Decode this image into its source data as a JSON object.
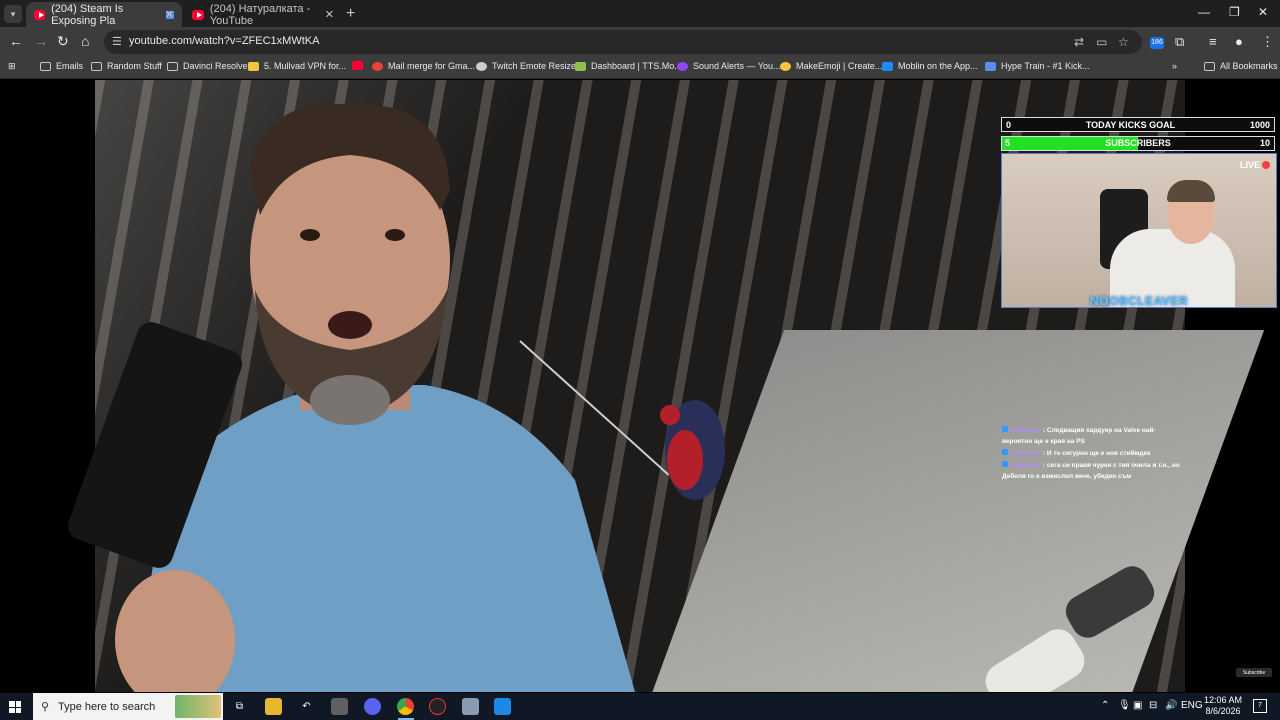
{
  "browser": {
    "tabs": [
      {
        "title": "(204) Steam Is Exposing Pla",
        "active": true
      },
      {
        "title": "(204) Натуралката - YouTube",
        "active": false
      }
    ],
    "url": "youtube.com/watch?v=ZFEC1xMWtKA",
    "extension_badge": "186"
  },
  "bookmarks": [
    {
      "label": "Emails",
      "icon": "folder-icon"
    },
    {
      "label": "Random Stuff",
      "icon": "folder-icon"
    },
    {
      "label": "Davinci Resolve",
      "icon": "folder-icon"
    },
    {
      "label": "5. Mullvad VPN for...",
      "icon": "mullvad-icon"
    },
    {
      "label": "",
      "icon": "youtube-icon"
    },
    {
      "label": "Mail merge for Gma...",
      "icon": "mail-merge-icon"
    },
    {
      "label": "Twitch Emote Resizer",
      "icon": "emote-resizer-icon"
    },
    {
      "label": "Dashboard | TTS.Mo...",
      "icon": "tts-icon"
    },
    {
      "label": "Sound Alerts — You...",
      "icon": "sound-alerts-icon"
    },
    {
      "label": "MakeEmoji | Create...",
      "icon": "makeemoji-icon"
    },
    {
      "label": "Moblin on the App...",
      "icon": "appstore-icon"
    },
    {
      "label": "Hype Train - #1 Kick...",
      "icon": "hype-train-icon"
    }
  ],
  "all_bookmarks_label": "All Bookmarks",
  "overlay": {
    "kicks_goal": {
      "current": "0",
      "label": "TODAY KICKS GOAL",
      "target": "1000",
      "progress": 0
    },
    "subscribers": {
      "current": "5",
      "label": "SUBSCRIBERS",
      "target": "10",
      "progress": 0.5
    },
    "live_label": "LIVE",
    "streamer_name": "NOOBCLEAVER",
    "chat": [
      {
        "user": "sslavchev",
        "text": ": Следващия хардуер на Valve най-вероятно ще е края на PS"
      },
      {
        "user": "sslavchev",
        "text": ": И то сигурно ще е нов стиймдек"
      },
      {
        "user": "sslavchev",
        "text": ": сега си правя чурки с тия очила и т.н., но Дебеля го е измислил вече, убеден съм"
      }
    ],
    "subscribe_badge": "Subscribe"
  },
  "taskbar": {
    "search_placeholder": "Type here to search",
    "language": "ENG",
    "time": "12:06 AM",
    "date": "8/6/2026",
    "notification_count": "7"
  },
  "colors": {
    "progress_green": "#22e022",
    "live_red": "#ff3b3b",
    "chat_username": "#b38cff",
    "streamer_name": "#5ac8fa"
  }
}
